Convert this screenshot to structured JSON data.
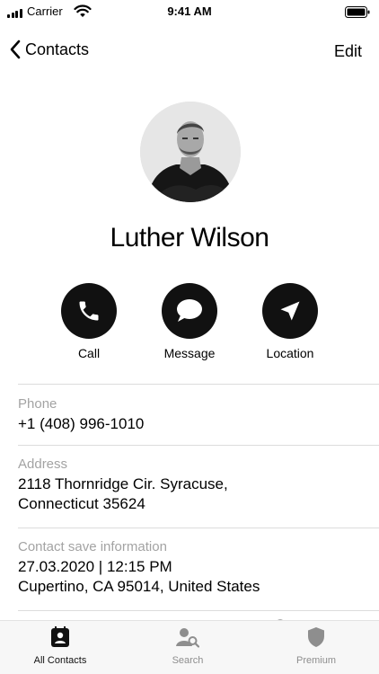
{
  "status_bar": {
    "carrier": "Carrier",
    "time": "9:41 AM"
  },
  "nav": {
    "back_label": "Contacts",
    "edit_label": "Edit"
  },
  "contact": {
    "name": "Luther Wilson"
  },
  "actions": [
    {
      "label": "Call",
      "icon": "phone-icon"
    },
    {
      "label": "Message",
      "icon": "message-icon"
    },
    {
      "label": "Location",
      "icon": "location-arrow-icon"
    }
  ],
  "fields": [
    {
      "key": "Phone",
      "lines": [
        "+1 (408) 996-1010"
      ]
    },
    {
      "key": "Address",
      "lines": [
        "2118 Thornridge Cir. Syracuse,",
        "Connecticut 35624"
      ]
    },
    {
      "key": "Contact save information",
      "lines": [
        "27.03.2020 | 12:15 PM",
        "Cupertino, CA 95014, United States"
      ]
    }
  ],
  "tabbar": {
    "items": [
      {
        "label": "All Contacts",
        "icon": "contacts-book-icon",
        "active": true
      },
      {
        "label": "Search",
        "icon": "person-search-icon",
        "active": false
      },
      {
        "label": "Premium",
        "icon": "shield-icon",
        "active": false
      }
    ]
  },
  "colors": {
    "accent": "#111111",
    "muted_text": "#a3a3a3",
    "divider": "#dcdcdc",
    "tabbar_bg": "#f7f7f7"
  }
}
